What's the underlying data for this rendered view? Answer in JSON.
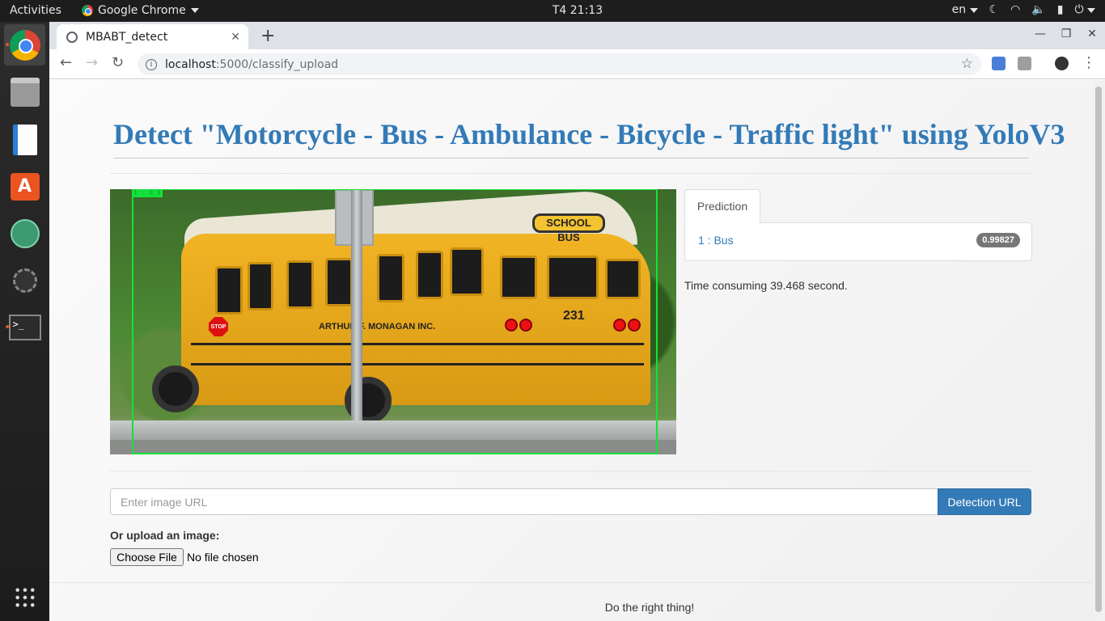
{
  "os": {
    "activities": "Activities",
    "app_name": "Google Chrome",
    "clock": "T4 21:13",
    "language": "en"
  },
  "browser": {
    "tab_title": "MBABT_detect",
    "url_host": "localhost",
    "url_path": ":5000/classify_upload"
  },
  "page": {
    "title": "Detect \"Motorcycle - Bus - Ambulance - Bicycle - Traffic light\" using YoloV3",
    "image_overlay": {
      "school_bus_sign": "SCHOOL BUS",
      "bus_number": "231",
      "company_text": "ARTHUR F. MONAGAN INC.",
      "stop_sign": "STOP",
      "bbox_label": "1 : 0.9"
    },
    "prediction": {
      "tab_label": "Prediction",
      "items": [
        {
          "label": "1 : Bus",
          "score": "0.99827"
        }
      ],
      "time_text": "Time consuming 39.468 second."
    },
    "form": {
      "url_placeholder": "Enter image URL",
      "url_button": "Detection URL",
      "upload_label": "Or upload an image:",
      "choose_file": "Choose File",
      "no_file": "No file chosen"
    },
    "footer": "Do the right thing!"
  },
  "colors": {
    "title_blue": "#337ab7",
    "bbox_green": "#14e23a",
    "badge_gray": "#777777"
  }
}
